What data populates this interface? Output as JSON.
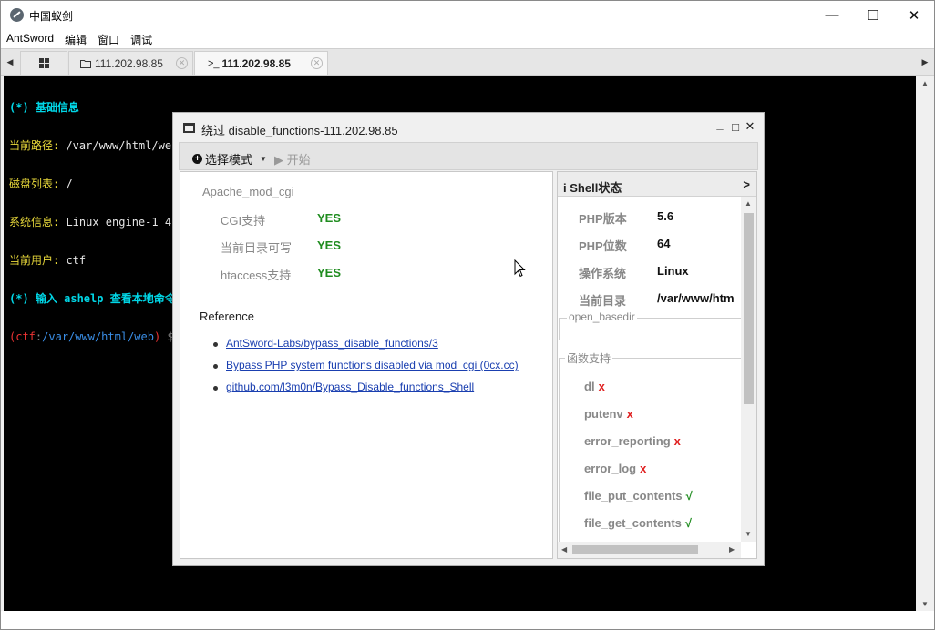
{
  "window": {
    "title": "中国蚁剑",
    "minimize": "—",
    "maximize": "☐",
    "close": "✕"
  },
  "menu": [
    "AntSword",
    "编辑",
    "窗口",
    "调试"
  ],
  "tabs": {
    "left_arrow": "◀",
    "right_arrow": "▶",
    "home_icon": "grid-icon",
    "items": [
      {
        "icon": "folder-icon",
        "label": "111.202.98.85",
        "close": "✕"
      },
      {
        "icon": "terminal-icon",
        "label": "111.202.98.85",
        "close": "✕",
        "active": true
      }
    ]
  },
  "terminal": {
    "lines": [
      {
        "k": "(*) 基础信息",
        "v": ""
      },
      {
        "k": "当前路径:",
        "v": " /var/www/html/web"
      },
      {
        "k": "磁盘列表:",
        "v": " /"
      },
      {
        "k": "系统信息:",
        "v": " Linux engine-1 4"
      },
      {
        "k": "当前用户:",
        "v": " ctf"
      },
      {
        "k": "(*) 输入 ashelp 查看本地命令",
        "v": ""
      }
    ],
    "prompt": {
      "open": "(",
      "user": "ctf",
      "sep": ":",
      "path": "/var/www/html/web",
      "close": ")",
      "sym": " $"
    }
  },
  "dialog": {
    "title": "绕过 disable_functions-111.202.98.85",
    "buttons": {
      "minimize": "_",
      "maximize": "□",
      "close": "✕"
    },
    "toolbar": {
      "mode_label": "选择模式",
      "caret": "▼",
      "start_label": "▶ 开始"
    },
    "module": {
      "name": "Apache_mod_cgi",
      "checks": [
        {
          "label": "CGI支持",
          "value": "YES"
        },
        {
          "label": "当前目录可写",
          "value": "YES"
        },
        {
          "label": "htaccess支持",
          "value": "YES"
        }
      ],
      "reference_title": "Reference",
      "references": [
        "AntSword-Labs/bypass_disable_functions/3",
        "Bypass PHP system functions disabled via mod_cgi (0cx.cc)",
        "github.com/l3m0n/Bypass_Disable_functions_Shell"
      ]
    },
    "shell_status": {
      "title": "Shell状态",
      "info_icon": "i",
      "arrow": ">",
      "info": [
        {
          "k": "PHP版本",
          "v": "5.6"
        },
        {
          "k": "PHP位数",
          "v": "64"
        },
        {
          "k": "操作系统",
          "v": "Linux"
        },
        {
          "k": "当前目录",
          "v": "/var/www/htm"
        }
      ],
      "open_basedir_label": "open_basedir",
      "functions_label": "函数支持",
      "functions": [
        {
          "name": "dl",
          "ok": false,
          "mark": "x"
        },
        {
          "name": "putenv",
          "ok": false,
          "mark": "x"
        },
        {
          "name": "error_reporting",
          "ok": false,
          "mark": "x"
        },
        {
          "name": "error_log",
          "ok": false,
          "mark": "x"
        },
        {
          "name": "file_put_contents",
          "ok": true,
          "mark": "√"
        },
        {
          "name": "file_get_contents",
          "ok": true,
          "mark": "√"
        }
      ]
    }
  },
  "colors": {
    "yes_green": "#1f8c1f",
    "mark_red": "#e02020",
    "mark_green": "#1f8c1f",
    "link_blue": "#1a3fb0",
    "terminal_cyan": "#00d6e6",
    "terminal_yellow": "#e8d83a"
  }
}
